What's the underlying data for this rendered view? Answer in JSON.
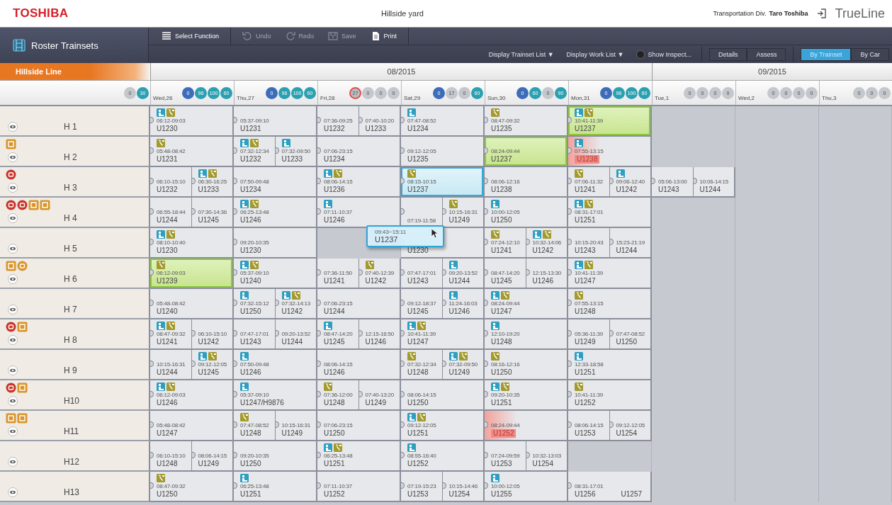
{
  "header": {
    "logo": "TOSHIBA",
    "title": "Hillside yard",
    "org": "Transportation Div.",
    "user": "Taro Toshiba",
    "product": "TrueLine"
  },
  "toolbar": {
    "panel_title": "Roster Trainsets",
    "actions": [
      {
        "label": "Select Function",
        "kind": "menu",
        "disabled": false
      },
      {
        "label": "Undo",
        "kind": "undo",
        "disabled": true
      },
      {
        "label": "Redo",
        "kind": "redo",
        "disabled": true
      },
      {
        "label": "Save",
        "kind": "save",
        "disabled": true
      },
      {
        "label": "Print",
        "kind": "print",
        "disabled": false
      }
    ],
    "dropdowns": [
      {
        "label": "Display Trainset List ▼"
      },
      {
        "label": "Display Work List ▼"
      }
    ],
    "toggle": {
      "label": "Show Inspect...",
      "on": false
    },
    "modes": [
      {
        "label": "Details",
        "selected": false
      },
      {
        "label": "Assess",
        "selected": false
      }
    ],
    "views": [
      {
        "label": "By Trainset",
        "selected": true
      },
      {
        "label": "By Car",
        "selected": false
      }
    ]
  },
  "line": "Hillside Line",
  "lead_counters": [
    {
      "value": "0",
      "color": "#c4c7cc",
      "alert": false
    },
    {
      "value": "30",
      "color": "#2aa0b0",
      "alert": false
    }
  ],
  "months": [
    {
      "label": "08/2015",
      "days": [
        {
          "label": "Wed,26",
          "counters": [
            {
              "value": "0",
              "color": "#3c6db8",
              "alert": false
            },
            {
              "value": "96",
              "color": "#2aa0b0",
              "alert": false
            },
            {
              "value": "100",
              "color": "#2aa0b0",
              "alert": false
            },
            {
              "value": "60",
              "color": "#2aa0b0",
              "alert": false
            }
          ]
        },
        {
          "label": "Thu,27",
          "counters": [
            {
              "value": "0",
              "color": "#3c6db8",
              "alert": false
            },
            {
              "value": "96",
              "color": "#2aa0b0",
              "alert": false
            },
            {
              "value": "100",
              "color": "#2aa0b0",
              "alert": false
            },
            {
              "value": "60",
              "color": "#2aa0b0",
              "alert": false
            }
          ]
        },
        {
          "label": "Fri,28",
          "counters": [
            {
              "value": "27",
              "color": "#b9bcc2",
              "alert": true
            },
            {
              "value": "0",
              "color": "#c4c7cc",
              "alert": false
            },
            {
              "value": "0",
              "color": "#c4c7cc",
              "alert": false
            },
            {
              "value": "0",
              "color": "#c4c7cc",
              "alert": false
            }
          ]
        },
        {
          "label": "Sat,29",
          "counters": [
            {
              "value": "0",
              "color": "#3c6db8",
              "alert": false
            },
            {
              "value": "17",
              "color": "#c4c7cc",
              "alert": false
            },
            {
              "value": "0",
              "color": "#c4c7cc",
              "alert": false
            },
            {
              "value": "60",
              "color": "#2aa0b0",
              "alert": false
            }
          ]
        },
        {
          "label": "Sun,30",
          "counters": [
            {
              "value": "0",
              "color": "#3c6db8",
              "alert": false
            },
            {
              "value": "60",
              "color": "#2aa0b0",
              "alert": false
            },
            {
              "value": "0",
              "color": "#c4c7cc",
              "alert": false
            },
            {
              "value": "90",
              "color": "#2aa0b0",
              "alert": false
            }
          ]
        },
        {
          "label": "Mon,31",
          "counters": [
            {
              "value": "0",
              "color": "#3c6db8",
              "alert": false
            },
            {
              "value": "96",
              "color": "#2aa0b0",
              "alert": false
            },
            {
              "value": "100",
              "color": "#2aa0b0",
              "alert": false
            },
            {
              "value": "60",
              "color": "#2aa0b0",
              "alert": false
            }
          ]
        }
      ]
    },
    {
      "label": "09/2015",
      "days": [
        {
          "label": "Tue,1",
          "counters": [
            {
              "value": "0",
              "color": "#c4c7cc",
              "alert": false
            },
            {
              "value": "0",
              "color": "#c4c7cc",
              "alert": false
            },
            {
              "value": "0",
              "color": "#c4c7cc",
              "alert": false
            },
            {
              "value": "0",
              "color": "#c4c7cc",
              "alert": false
            }
          ]
        },
        {
          "label": "Wed,2",
          "counters": [
            {
              "value": "0",
              "color": "#c4c7cc",
              "alert": false
            },
            {
              "value": "0",
              "color": "#c4c7cc",
              "alert": false
            },
            {
              "value": "0",
              "color": "#c4c7cc",
              "alert": false
            },
            {
              "value": "0",
              "color": "#c4c7cc",
              "alert": false
            }
          ]
        },
        {
          "label": "Thu,3",
          "counters": [
            {
              "value": "0",
              "color": "#c4c7cc",
              "alert": false
            },
            {
              "value": "0",
              "color": "#c4c7cc",
              "alert": false
            },
            {
              "value": "0",
              "color": "#c4c7cc",
              "alert": false
            }
          ]
        }
      ]
    }
  ],
  "trainsets": [
    {
      "name": "H 1",
      "days": [
        {
          "kind": "duty",
          "pieces": [
            {
              "time": "06:12-09:03",
              "unit": "U1230",
              "icons": [
                {
                  "kind": "crew"
                },
                {
                  "kind": "tool"
                }
              ],
              "kind": "plain"
            }
          ]
        },
        {
          "kind": "duty",
          "pieces": [
            {
              "time": "05:37-09:10",
              "unit": "U1231",
              "kind": "plain"
            }
          ]
        },
        {
          "kind": "duty",
          "pieces": [
            {
              "time": "07:36-09:25",
              "unit": "U1232",
              "kind": "plain"
            },
            {
              "time": "07:40-10:20",
              "unit": "U1233",
              "kind": "plain"
            }
          ]
        },
        {
          "kind": "duty",
          "pieces": [
            {
              "time": "07:47-08:52",
              "unit": "U1234",
              "icons": [
                {
                  "kind": "crew"
                }
              ],
              "kind": "plain"
            }
          ]
        },
        {
          "kind": "duty",
          "pieces": [
            {
              "time": "08:47-09:32",
              "unit": "U1235",
              "icons": [
                {
                  "kind": "tool"
                }
              ],
              "kind": "plain"
            }
          ]
        },
        {
          "kind": "duty",
          "pieces": [
            {
              "time": "10:41-11:39",
              "unit": "U1237",
              "icons": [
                {
                  "kind": "crew"
                },
                {
                  "kind": "tool"
                }
              ],
              "kind": "assigned"
            }
          ]
        },
        {
          "kind": "open"
        },
        {
          "kind": "open"
        },
        {
          "kind": "open"
        }
      ]
    },
    {
      "name": "H 2",
      "badges": [
        {
          "kind": "square",
          "color": "#d9952b"
        }
      ],
      "days": [
        {
          "kind": "duty",
          "pieces": [
            {
              "time": "05:48-08:42",
              "unit": "U1231",
              "icons": [
                {
                  "kind": "tool"
                }
              ],
              "kind": "plain"
            }
          ]
        },
        {
          "kind": "duty",
          "pieces": [
            {
              "time": "07:32-12:34",
              "unit": "U1232",
              "icons": [
                {
                  "kind": "crew"
                },
                {
                  "kind": "tool"
                }
              ],
              "kind": "plain"
            },
            {
              "time": "07:32-09:50",
              "unit": "U1233",
              "icons": [
                {
                  "kind": "crew"
                }
              ],
              "kind": "plain"
            }
          ]
        },
        {
          "kind": "duty",
          "pieces": [
            {
              "time": "07:06-23:15",
              "unit": "U1234",
              "kind": "plain"
            }
          ]
        },
        {
          "kind": "duty",
          "pieces": [
            {
              "time": "09:12-12:05",
              "unit": "U1235",
              "kind": "plain"
            }
          ]
        },
        {
          "kind": "duty",
          "pieces": [
            {
              "time": "08:24-09:44",
              "unit": "U1237",
              "kind": "assigned"
            }
          ]
        },
        {
          "kind": "duty",
          "pieces": [
            {
              "time": "07:55-13:15",
              "unit": "U1238",
              "icons": [
                {
                  "kind": "crew"
                }
              ],
              "kind": "conflict"
            }
          ]
        },
        {
          "kind": "open"
        },
        {
          "kind": "open"
        },
        {
          "kind": "open"
        }
      ]
    },
    {
      "name": "H 3",
      "badges": [
        {
          "kind": "round",
          "color": "#c9362c"
        }
      ],
      "days": [
        {
          "kind": "duty",
          "pieces": [
            {
              "time": "06:10-15:10",
              "unit": "U1232",
              "kind": "plain"
            },
            {
              "time": "06:30-16:25",
              "unit": "U1233",
              "icons": [
                {
                  "kind": "crew"
                },
                {
                  "kind": "tool"
                }
              ],
              "kind": "plain"
            }
          ]
        },
        {
          "kind": "duty",
          "pieces": [
            {
              "time": "07:50-09:48",
              "unit": "U1234",
              "kind": "plain"
            }
          ]
        },
        {
          "kind": "duty",
          "pieces": [
            {
              "time": "08:06-14:15",
              "unit": "U1236",
              "icons": [
                {
                  "kind": "crew"
                },
                {
                  "kind": "tool"
                }
              ],
              "kind": "plain"
            }
          ]
        },
        {
          "kind": "duty",
          "pieces": [
            {
              "time": "08:15-10:15",
              "unit": "U1237",
              "icons": [
                {
                  "kind": "tool"
                }
              ],
              "kind": "active"
            }
          ]
        },
        {
          "kind": "duty",
          "pieces": [
            {
              "time": "08:06-12:16",
              "unit": "U1238",
              "kind": "plain"
            }
          ]
        },
        {
          "kind": "duty",
          "pieces": [
            {
              "time": "07:06-11:32",
              "unit": "U1241",
              "icons": [
                {
                  "kind": "tool"
                }
              ],
              "kind": "plain"
            },
            {
              "time": "09:06-12:40",
              "unit": "U1242",
              "icons": [
                {
                  "kind": "crew"
                }
              ],
              "kind": "plain"
            }
          ]
        },
        {
          "kind": "duty",
          "pieces": [
            {
              "time": "05:06-13:00",
              "unit": "U1243",
              "kind": "plain"
            },
            {
              "time": "10:06-14:15",
              "unit": "U1244",
              "kind": "plain"
            }
          ]
        },
        {
          "kind": "open"
        },
        {
          "kind": "open"
        }
      ]
    },
    {
      "name": "H 4",
      "badges": [
        {
          "kind": "round",
          "color": "#c9362c"
        },
        {
          "kind": "round",
          "color": "#c9362c"
        },
        {
          "kind": "square",
          "color": "#d9952b"
        },
        {
          "kind": "square",
          "color": "#d9952b"
        }
      ],
      "days": [
        {
          "kind": "duty",
          "pieces": [
            {
              "time": "06:55-18:44",
              "unit": "U1244",
              "kind": "plain"
            },
            {
              "time": "07:30-14:36",
              "unit": "U1245",
              "kind": "plain"
            }
          ]
        },
        {
          "kind": "duty",
          "pieces": [
            {
              "time": "06:25-13:48",
              "unit": "U1246",
              "icons": [
                {
                  "kind": "crew"
                },
                {
                  "kind": "tool"
                }
              ],
              "kind": "plain"
            }
          ]
        },
        {
          "kind": "duty",
          "pieces": [
            {
              "time": "07:11-10:37",
              "unit": "U1246",
              "icons": [
                {
                  "kind": "crew"
                }
              ],
              "kind": "plain"
            }
          ]
        },
        {
          "kind": "duty",
          "pieces": [
            {
              "time": "07:19-11:58",
              "kind": "plain"
            },
            {
              "time": "10:15-16:31",
              "unit": "U1249",
              "icons": [
                {
                  "kind": "tool"
                }
              ],
              "kind": "plain"
            }
          ]
        },
        {
          "kind": "duty",
          "pieces": [
            {
              "time": "10:00-12:05",
              "unit": "U1250",
              "icons": [
                {
                  "kind": "crew"
                }
              ],
              "kind": "plain"
            }
          ]
        },
        {
          "kind": "duty",
          "pieces": [
            {
              "time": "08:31-17:01",
              "unit": "U1251",
              "icons": [
                {
                  "kind": "crew"
                },
                {
                  "kind": "tool"
                }
              ],
              "kind": "plain"
            }
          ]
        },
        {
          "kind": "open"
        },
        {
          "kind": "open"
        },
        {
          "kind": "open"
        }
      ]
    },
    {
      "name": "H 5",
      "days": [
        {
          "kind": "duty",
          "pieces": [
            {
              "time": "08:10-10:40",
              "unit": "U1230",
              "icons": [
                {
                  "kind": "crew"
                },
                {
                  "kind": "tool"
                }
              ],
              "kind": "plain"
            }
          ]
        },
        {
          "kind": "duty",
          "pieces": [
            {
              "time": "09:20-10:35",
              "unit": "U1230",
              "kind": "plain"
            }
          ]
        },
        {
          "kind": "open"
        },
        {
          "kind": "duty",
          "pieces": [
            {
              "unit": "U1230",
              "kind": "plain"
            }
          ]
        },
        {
          "kind": "duty",
          "pieces": [
            {
              "time": "07:24-12:10",
              "unit": "U1241",
              "icons": [
                {
                  "kind": "tool"
                }
              ],
              "kind": "plain"
            },
            {
              "time": "10:32-14:06",
              "unit": "U1242",
              "icons": [
                {
                  "kind": "crew"
                },
                {
                  "kind": "tool"
                }
              ],
              "kind": "plain"
            }
          ]
        },
        {
          "kind": "duty",
          "pieces": [
            {
              "time": "10:15-20:43",
              "unit": "U1243",
              "kind": "plain"
            },
            {
              "time": "15:23-21:19",
              "unit": "U1244",
              "kind": "plain"
            }
          ]
        },
        {
          "kind": "open"
        },
        {
          "kind": "open"
        },
        {
          "kind": "open"
        }
      ]
    },
    {
      "name": "H 6",
      "badges": [
        {
          "kind": "square",
          "color": "#d9952b"
        },
        {
          "kind": "round",
          "color": "#d9952b"
        }
      ],
      "days": [
        {
          "kind": "duty",
          "pieces": [
            {
              "time": "06:12-09:03",
              "unit": "U1239",
              "icons": [
                {
                  "kind": "tool"
                }
              ],
              "kind": "assigned"
            }
          ]
        },
        {
          "kind": "duty",
          "pieces": [
            {
              "time": "05:37-09:10",
              "unit": "U1240",
              "icons": [
                {
                  "kind": "crew"
                },
                {
                  "kind": "tool"
                }
              ],
              "kind": "plain"
            }
          ]
        },
        {
          "kind": "duty",
          "pieces": [
            {
              "time": "07:36-11:50",
              "unit": "U1241",
              "kind": "plain"
            },
            {
              "time": "07:40-12:39",
              "unit": "U1242",
              "icons": [
                {
                  "kind": "tool"
                }
              ],
              "kind": "plain"
            }
          ]
        },
        {
          "kind": "duty",
          "pieces": [
            {
              "time": "07:47-17:01",
              "unit": "U1243",
              "kind": "plain"
            },
            {
              "time": "09:20-13:52",
              "unit": "U1244",
              "icons": [
                {
                  "kind": "crew"
                }
              ],
              "kind": "plain"
            }
          ]
        },
        {
          "kind": "duty",
          "pieces": [
            {
              "time": "08:47-14:20",
              "unit": "U1245",
              "kind": "plain"
            },
            {
              "time": "12:15-13:30",
              "unit": "U1246",
              "kind": "plain"
            }
          ]
        },
        {
          "kind": "duty",
          "pieces": [
            {
              "time": "10:41-11:39",
              "unit": "U1247",
              "icons": [
                {
                  "kind": "crew"
                },
                {
                  "kind": "tool"
                }
              ],
              "kind": "plain"
            }
          ]
        },
        {
          "kind": "open"
        },
        {
          "kind": "open"
        },
        {
          "kind": "open"
        }
      ]
    },
    {
      "name": "H 7",
      "days": [
        {
          "kind": "duty",
          "pieces": [
            {
              "time": "05:48-08:42",
              "unit": "U1240",
              "kind": "plain"
            }
          ]
        },
        {
          "kind": "duty",
          "pieces": [
            {
              "time": "07:32-15:12",
              "unit": "U1250",
              "icons": [
                {
                  "kind": "crew"
                }
              ],
              "kind": "plain"
            },
            {
              "time": "07:32-14:13",
              "unit": "U1242",
              "icons": [
                {
                  "kind": "crew"
                },
                {
                  "kind": "tool"
                }
              ],
              "kind": "plain"
            }
          ]
        },
        {
          "kind": "duty",
          "pieces": [
            {
              "time": "07:06-23:15",
              "unit": "U1244",
              "kind": "plain"
            }
          ]
        },
        {
          "kind": "duty",
          "pieces": [
            {
              "time": "09:12-18:37",
              "unit": "U1245",
              "kind": "plain"
            },
            {
              "time": "11:24-16:03",
              "unit": "U1246",
              "icons": [
                {
                  "kind": "crew"
                }
              ],
              "kind": "plain"
            }
          ]
        },
        {
          "kind": "duty",
          "pieces": [
            {
              "time": "08:24-09:44",
              "unit": "U1247",
              "icons": [
                {
                  "kind": "crew"
                },
                {
                  "kind": "tool"
                }
              ],
              "kind": "plain"
            }
          ]
        },
        {
          "kind": "duty",
          "pieces": [
            {
              "time": "07:55-13:15",
              "unit": "U1248",
              "icons": [
                {
                  "kind": "tool"
                }
              ],
              "kind": "plain"
            }
          ]
        },
        {
          "kind": "open"
        },
        {
          "kind": "open"
        },
        {
          "kind": "open"
        }
      ]
    },
    {
      "name": "H 8",
      "badges": [
        {
          "kind": "round",
          "color": "#c9362c"
        },
        {
          "kind": "square",
          "color": "#d9952b"
        }
      ],
      "days": [
        {
          "kind": "duty",
          "pieces": [
            {
              "time": "08:47-09:32",
              "unit": "U1241",
              "icons": [
                {
                  "kind": "crew"
                },
                {
                  "kind": "tool"
                }
              ],
              "kind": "plain"
            },
            {
              "time": "06:10-15:10",
              "unit": "U1242",
              "kind": "plain"
            }
          ]
        },
        {
          "kind": "duty",
          "pieces": [
            {
              "time": "07:47-17:01",
              "unit": "U1243",
              "kind": "plain"
            },
            {
              "time": "09:20-13:52",
              "unit": "U1244",
              "kind": "plain"
            }
          ]
        },
        {
          "kind": "duty",
          "pieces": [
            {
              "time": "08:47-14:20",
              "unit": "U1245",
              "icons": [
                {
                  "kind": "crew"
                }
              ],
              "kind": "plain"
            },
            {
              "time": "12:15-16:50",
              "unit": "U1246",
              "kind": "plain"
            }
          ]
        },
        {
          "kind": "duty",
          "pieces": [
            {
              "time": "10:41-11:39",
              "unit": "U1247",
              "icons": [
                {
                  "kind": "crew"
                },
                {
                  "kind": "tool"
                }
              ],
              "kind": "plain"
            }
          ]
        },
        {
          "kind": "duty",
          "pieces": [
            {
              "time": "12:10-19:20",
              "unit": "U1248",
              "icons": [
                {
                  "kind": "crew"
                }
              ],
              "kind": "plain"
            }
          ]
        },
        {
          "kind": "duty",
          "pieces": [
            {
              "time": "05:36-11:39",
              "unit": "U1249",
              "kind": "plain"
            },
            {
              "time": "07:47-08:52",
              "unit": "U1250",
              "kind": "plain"
            }
          ]
        },
        {
          "kind": "open"
        },
        {
          "kind": "open"
        },
        {
          "kind": "open"
        }
      ]
    },
    {
      "name": "H 9",
      "days": [
        {
          "kind": "duty",
          "pieces": [
            {
              "time": "10:15-16:31",
              "unit": "U1244",
              "kind": "plain"
            },
            {
              "time": "09:12-12:05",
              "unit": "U1245",
              "icons": [
                {
                  "kind": "crew"
                },
                {
                  "kind": "tool"
                }
              ],
              "kind": "plain"
            }
          ]
        },
        {
          "kind": "duty",
          "pieces": [
            {
              "time": "07:50-09:48",
              "unit": "U1246",
              "icons": [
                {
                  "kind": "crew"
                }
              ],
              "kind": "plain"
            }
          ]
        },
        {
          "kind": "duty",
          "pieces": [
            {
              "time": "08:06-14:15",
              "unit": "U1246",
              "kind": "plain"
            }
          ]
        },
        {
          "kind": "duty",
          "pieces": [
            {
              "time": "07:32-12:34",
              "unit": "U1248",
              "icons": [
                {
                  "kind": "tool"
                }
              ],
              "kind": "plain"
            },
            {
              "time": "07:32-09:50",
              "unit": "U1249",
              "icons": [
                {
                  "kind": "crew"
                },
                {
                  "kind": "tool"
                }
              ],
              "kind": "plain"
            }
          ]
        },
        {
          "kind": "duty",
          "pieces": [
            {
              "time": "08:16-12:16",
              "unit": "U1250",
              "icons": [
                {
                  "kind": "tool"
                }
              ],
              "kind": "plain"
            }
          ]
        },
        {
          "kind": "duty",
          "pieces": [
            {
              "time": "12:33-18:58",
              "unit": "U1251",
              "icons": [
                {
                  "kind": "crew"
                }
              ],
              "kind": "plain"
            }
          ]
        },
        {
          "kind": "open"
        },
        {
          "kind": "open"
        },
        {
          "kind": "open"
        }
      ]
    },
    {
      "name": "H10",
      "badges": [
        {
          "kind": "round",
          "color": "#c9362c"
        },
        {
          "kind": "square",
          "color": "#d9952b"
        }
      ],
      "days": [
        {
          "kind": "duty",
          "pieces": [
            {
              "time": "06:12-09:03",
              "unit": "U1246",
              "icons": [
                {
                  "kind": "crew"
                },
                {
                  "kind": "tool"
                }
              ],
              "kind": "plain"
            }
          ]
        },
        {
          "kind": "duty",
          "pieces": [
            {
              "time": "05:37-09:10",
              "unit": "U1247/H9876",
              "icons": [
                {
                  "kind": "crew"
                }
              ],
              "kind": "plain"
            }
          ]
        },
        {
          "kind": "duty",
          "pieces": [
            {
              "time": "07:36-12:00",
              "unit": "U1248",
              "icons": [
                {
                  "kind": "tool"
                }
              ],
              "kind": "plain"
            },
            {
              "time": "07:40-13:20",
              "unit": "U1249",
              "kind": "plain"
            }
          ]
        },
        {
          "kind": "duty",
          "pieces": [
            {
              "time": "08:06-14:15",
              "unit": "U1250",
              "kind": "plain"
            }
          ]
        },
        {
          "kind": "duty",
          "pieces": [
            {
              "time": "09:20-10:35",
              "unit": "U1251",
              "icons": [
                {
                  "kind": "crew"
                },
                {
                  "kind": "tool"
                }
              ],
              "kind": "plain"
            }
          ]
        },
        {
          "kind": "duty",
          "pieces": [
            {
              "time": "10:41-11:39",
              "unit": "U1252",
              "icons": [
                {
                  "kind": "tool"
                }
              ],
              "kind": "plain"
            }
          ]
        },
        {
          "kind": "open"
        },
        {
          "kind": "open"
        },
        {
          "kind": "open"
        }
      ]
    },
    {
      "name": "H11",
      "badges": [
        {
          "kind": "square",
          "color": "#d9952b"
        },
        {
          "kind": "square",
          "color": "#d9952b"
        }
      ],
      "days": [
        {
          "kind": "duty",
          "pieces": [
            {
              "time": "05:48-08:42",
              "unit": "U1247",
              "kind": "plain"
            }
          ]
        },
        {
          "kind": "duty",
          "pieces": [
            {
              "time": "07:47-08:52",
              "unit": "U1248",
              "icons": [
                {
                  "kind": "tool"
                }
              ],
              "kind": "plain"
            },
            {
              "time": "10:15-16:31",
              "unit": "U1249",
              "kind": "plain"
            }
          ]
        },
        {
          "kind": "duty",
          "pieces": [
            {
              "time": "07:06-23:15",
              "unit": "U1250",
              "kind": "plain"
            }
          ]
        },
        {
          "kind": "duty",
          "pieces": [
            {
              "time": "09:12-12:05",
              "unit": "U1251",
              "icons": [
                {
                  "kind": "crew"
                },
                {
                  "kind": "tool"
                }
              ],
              "kind": "plain"
            }
          ]
        },
        {
          "kind": "duty",
          "pieces": [
            {
              "time": "08:24-09:44",
              "unit": "U1252",
              "kind": "conflict"
            }
          ]
        },
        {
          "kind": "duty",
          "pieces": [
            {
              "time": "08:06-14:15",
              "unit": "U1253",
              "kind": "plain"
            },
            {
              "time": "09:12-12:05",
              "unit": "U1254",
              "kind": "plain"
            }
          ]
        },
        {
          "kind": "open"
        },
        {
          "kind": "open"
        },
        {
          "kind": "open"
        }
      ]
    },
    {
      "name": "H12",
      "days": [
        {
          "kind": "duty",
          "pieces": [
            {
              "time": "06:10-15:10",
              "unit": "U1248",
              "kind": "plain"
            },
            {
              "time": "08:06-14:15",
              "unit": "U1249",
              "kind": "plain"
            }
          ]
        },
        {
          "kind": "duty",
          "pieces": [
            {
              "time": "09:20-10:35",
              "unit": "U1250",
              "kind": "plain"
            }
          ]
        },
        {
          "kind": "duty",
          "pieces": [
            {
              "time": "06:25-13:48",
              "unit": "U1251",
              "icons": [
                {
                  "kind": "crew"
                },
                {
                  "kind": "tool"
                }
              ],
              "kind": "plain"
            }
          ]
        },
        {
          "kind": "duty",
          "pieces": [
            {
              "time": "08:55-16:40",
              "unit": "U1252",
              "icons": [
                {
                  "kind": "crew"
                }
              ],
              "kind": "plain"
            }
          ]
        },
        {
          "kind": "duty",
          "pieces": [
            {
              "time": "07:24-09:59",
              "unit": "U1253",
              "kind": "plain"
            },
            {
              "time": "10:32-13:03",
              "unit": "U1254",
              "kind": "plain"
            }
          ]
        },
        {
          "kind": "open"
        },
        {
          "kind": "open"
        },
        {
          "kind": "open"
        },
        {
          "kind": "open"
        }
      ]
    },
    {
      "name": "H13",
      "days": [
        {
          "kind": "duty",
          "pieces": [
            {
              "time": "08:47-09:32",
              "unit": "U1250",
              "icons": [
                {
                  "kind": "tool"
                }
              ],
              "kind": "plain"
            }
          ]
        },
        {
          "kind": "duty",
          "pieces": [
            {
              "time": "06:25-13:48",
              "unit": "U1251",
              "icons": [
                {
                  "kind": "crew"
                }
              ],
              "kind": "plain"
            }
          ]
        },
        {
          "kind": "duty",
          "pieces": [
            {
              "time": "07:11-10:37",
              "unit": "U1252",
              "kind": "plain"
            }
          ]
        },
        {
          "kind": "duty",
          "pieces": [
            {
              "time": "07:19-15:23",
              "unit": "U1253",
              "kind": "plain"
            },
            {
              "time": "10:15-14:46",
              "unit": "U1254",
              "kind": "plain"
            }
          ]
        },
        {
          "kind": "duty",
          "pieces": [
            {
              "time": "10:00-12:05",
              "unit": "U1255",
              "icons": [
                {
                  "kind": "crew"
                }
              ],
              "kind": "plain"
            }
          ]
        },
        {
          "kind": "duty",
          "pieces": [
            {
              "time": "08:31-17:01",
              "unit": "U1256",
              "unit_2": "U1257",
              "kind": "plain"
            }
          ]
        },
        {
          "kind": "open"
        },
        {
          "kind": "open"
        },
        {
          "kind": "open"
        }
      ]
    }
  ],
  "drag_card": {
    "time": "09:43~15:11",
    "unit": "U1237"
  }
}
